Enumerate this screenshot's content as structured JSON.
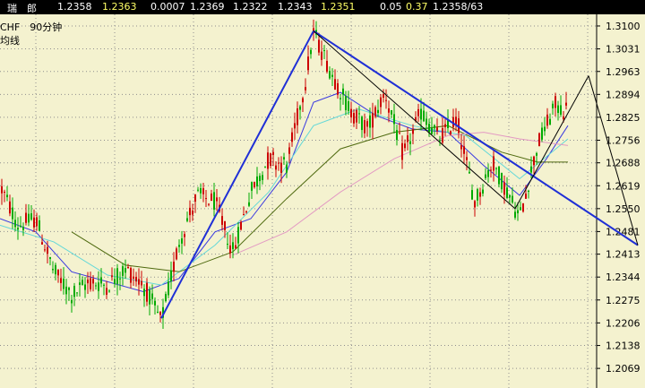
{
  "quote_bar": {
    "symbol": "瑞　郎",
    "values": [
      "1.2358",
      "1.2363",
      "0.0007",
      "1.2369",
      "1.2322",
      "1.2343",
      "1.2351",
      "0.05",
      "0.37",
      "1.2358/63"
    ],
    "colors": [
      "#ffffff",
      "#ffffff",
      "#ffff66",
      "#ffffff",
      "#ffffff",
      "#ffffff",
      "#ffffff",
      "#ffff66",
      "#ffffff",
      "#ffff66"
    ]
  },
  "header": {
    "line1": "CHF　90分钟",
    "line2": "均线"
  },
  "colors": {
    "background": "#f4f2cf",
    "up_candle": "#00aa00",
    "down_candle": "#cc0000",
    "trendline": "#1f2fd6",
    "ma_blue": "#3a3ae0",
    "ma_cyan": "#64d8d8",
    "ma_olive": "#4f6a10",
    "ma_pink": "#e39ac3"
  },
  "chart_data": {
    "type": "candlestick",
    "y_axis": {
      "labels": [
        "1.3100",
        "1.3031",
        "1.2963",
        "1.2894",
        "1.2825",
        "1.2756",
        "1.2688",
        "1.2619",
        "1.2550",
        "1.2481",
        "1.2413",
        "1.2344",
        "1.2275",
        "1.2206",
        "1.2138",
        "1.2069"
      ],
      "range": [
        1.201,
        1.3135
      ]
    },
    "price_path": [
      [
        0,
        1.262
      ],
      [
        20,
        1.25
      ],
      [
        40,
        1.252
      ],
      [
        60,
        1.236
      ],
      [
        80,
        1.229
      ],
      [
        100,
        1.233
      ],
      [
        120,
        1.232
      ],
      [
        140,
        1.237
      ],
      [
        160,
        1.232
      ],
      [
        180,
        1.221
      ],
      [
        200,
        1.245
      ],
      [
        220,
        1.259
      ],
      [
        240,
        1.257
      ],
      [
        260,
        1.242
      ],
      [
        280,
        1.26
      ],
      [
        300,
        1.27
      ],
      [
        320,
        1.268
      ],
      [
        340,
        1.292
      ],
      [
        350,
        1.308
      ],
      [
        370,
        1.296
      ],
      [
        390,
        1.285
      ],
      [
        410,
        1.279
      ],
      [
        430,
        1.29
      ],
      [
        450,
        1.271
      ],
      [
        470,
        1.284
      ],
      [
        490,
        1.276
      ],
      [
        510,
        1.282
      ],
      [
        530,
        1.257
      ],
      [
        550,
        1.269
      ],
      [
        570,
        1.258
      ],
      [
        580,
        1.252
      ],
      [
        600,
        1.274
      ],
      [
        620,
        1.286
      ],
      [
        634,
        1.284
      ]
    ],
    "moving_averages": [
      {
        "color": "ma_blue",
        "points": [
          [
            0,
            1.252
          ],
          [
            40,
            1.248
          ],
          [
            80,
            1.236
          ],
          [
            120,
            1.233
          ],
          [
            160,
            1.23
          ],
          [
            200,
            1.234
          ],
          [
            240,
            1.248
          ],
          [
            280,
            1.252
          ],
          [
            320,
            1.266
          ],
          [
            350,
            1.287
          ],
          [
            380,
            1.29
          ],
          [
            420,
            1.283
          ],
          [
            460,
            1.279
          ],
          [
            500,
            1.278
          ],
          [
            540,
            1.268
          ],
          [
            580,
            1.259
          ],
          [
            610,
            1.27
          ],
          [
            634,
            1.28
          ]
        ]
      },
      {
        "color": "ma_cyan",
        "points": [
          [
            0,
            1.25
          ],
          [
            60,
            1.245
          ],
          [
            120,
            1.235
          ],
          [
            180,
            1.232
          ],
          [
            240,
            1.244
          ],
          [
            300,
            1.26
          ],
          [
            350,
            1.28
          ],
          [
            400,
            1.285
          ],
          [
            460,
            1.28
          ],
          [
            520,
            1.277
          ],
          [
            580,
            1.264
          ],
          [
            634,
            1.276
          ]
        ]
      },
      {
        "color": "ma_olive",
        "points": [
          [
            80,
            1.248
          ],
          [
            140,
            1.238
          ],
          [
            200,
            1.236
          ],
          [
            260,
            1.242
          ],
          [
            320,
            1.258
          ],
          [
            380,
            1.273
          ],
          [
            440,
            1.278
          ],
          [
            500,
            1.28
          ],
          [
            560,
            1.272
          ],
          [
            600,
            1.269
          ],
          [
            634,
            1.269
          ]
        ]
      },
      {
        "color": "ma_pink",
        "points": [
          [
            260,
            1.241
          ],
          [
            320,
            1.248
          ],
          [
            380,
            1.26
          ],
          [
            440,
            1.27
          ],
          [
            500,
            1.277
          ],
          [
            540,
            1.278
          ],
          [
            580,
            1.276
          ],
          [
            634,
            1.274
          ]
        ]
      }
    ],
    "trend_lines": [
      {
        "color": "trendline",
        "from": [
          180,
          1.222
        ],
        "to": [
          350,
          1.3085
        ]
      },
      {
        "color": "trendline",
        "from": [
          350,
          1.3085
        ],
        "to": [
          712,
          1.244
        ]
      },
      {
        "color": "#000000",
        "from": [
          350,
          1.3085
        ],
        "to": [
          575,
          1.255
        ]
      },
      {
        "color": "#000000",
        "from": [
          575,
          1.255
        ],
        "to": [
          657,
          1.295
        ]
      },
      {
        "color": "#000000",
        "from": [
          657,
          1.295
        ],
        "to": [
          712,
          1.244
        ]
      }
    ]
  }
}
